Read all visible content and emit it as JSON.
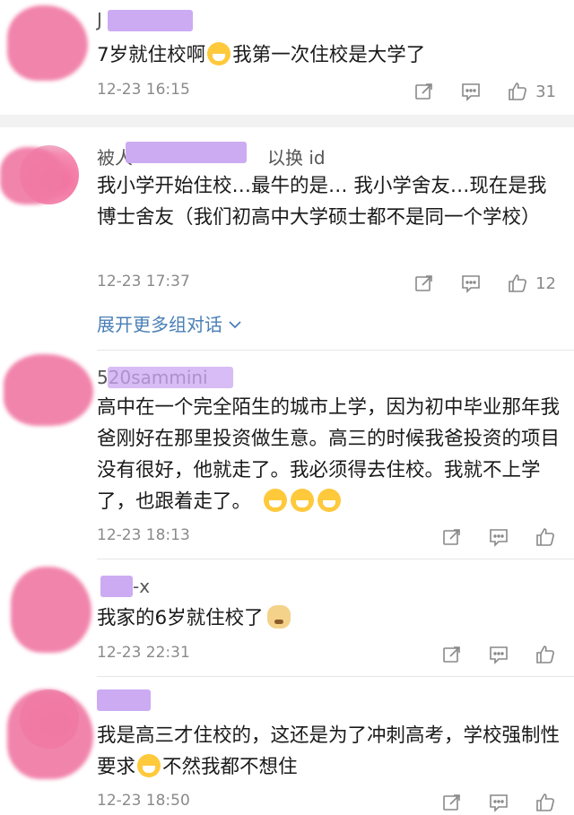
{
  "comments": [
    {
      "username": "J",
      "username_visible_suffix": "",
      "text_before": "7岁就住校啊",
      "emoji": "laugh-cry-emoji",
      "text_after": "我第一次住校是大学了",
      "time": "12-23 16:15",
      "likes": "31"
    },
    {
      "username": "被人",
      "username_visible_suffix": "以换 id",
      "text": "我小学开始住校…最牛的是… 我小学舍友…现在是我博士舍友（我们初高中大学硕士都不是同一个学校）",
      "time": "12-23 17:37",
      "likes": "12",
      "expand_label": "展开更多组对话"
    },
    {
      "username": "520sammini",
      "text": "高中在一个完全陌生的城市上学，因为初中毕业那年我爸刚好在那里投资做生意。高三的时候我爸投资的项目没有很好，他就走了。我必须得去住校。我就不上学了，也跟着走了。",
      "time": "12-23 18:13"
    },
    {
      "username": "-x",
      "text": "我家的6岁就住校了",
      "time": "12-23 22:31"
    },
    {
      "username": "",
      "text_before": "我是高三才住校的，这还是为了冲刺高考，学校强制性要求",
      "text_after": "不然我都不想住",
      "time": "12-23 18:50"
    }
  ],
  "colors": {
    "link": "#4a7fb5",
    "meta_gray": "#8a8a8a",
    "divider": "#f2f2f2"
  }
}
